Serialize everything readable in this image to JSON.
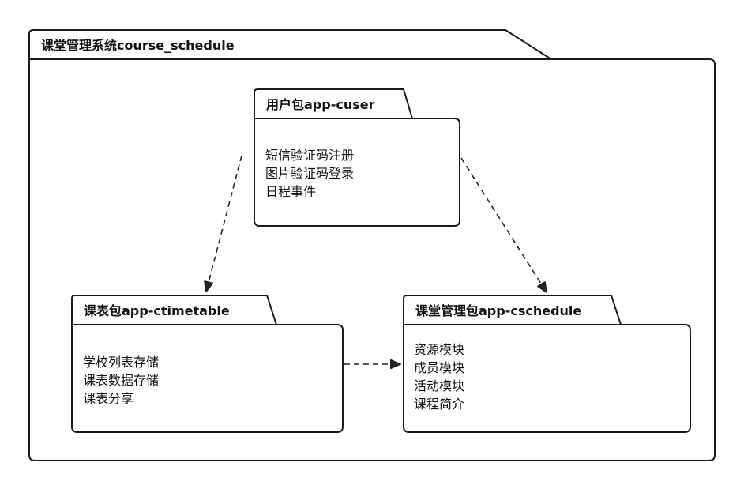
{
  "system": {
    "title": "课堂管理系统course_schedule"
  },
  "packages": {
    "user": {
      "name": "用户包app-cuser",
      "items": [
        "短信验证码注册",
        "图片验证码登录",
        "日程事件"
      ]
    },
    "timetable": {
      "name": "课表包app-ctimetable",
      "items": [
        "学校列表存储",
        "课表数据存储",
        "课表分享"
      ]
    },
    "schedule": {
      "name": "课堂管理包app-cschedule",
      "items": [
        "资源模块",
        "成员模块",
        "活动模块",
        "课程简介"
      ]
    }
  },
  "dependencies": [
    {
      "from": "user",
      "to": "timetable",
      "style": "dashed-arrow"
    },
    {
      "from": "user",
      "to": "schedule",
      "style": "dashed-arrow"
    },
    {
      "from": "timetable",
      "to": "schedule",
      "style": "dashed-arrow"
    }
  ]
}
